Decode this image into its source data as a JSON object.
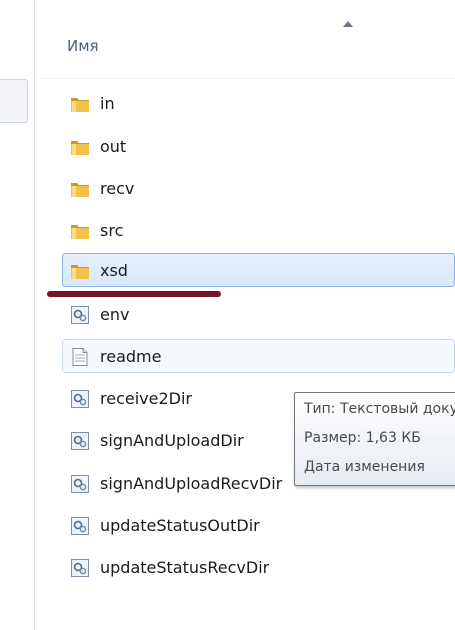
{
  "header": {
    "column_name": "Имя"
  },
  "files": [
    {
      "name": "in",
      "type": "folder"
    },
    {
      "name": "out",
      "type": "folder"
    },
    {
      "name": "recv",
      "type": "folder"
    },
    {
      "name": "src",
      "type": "folder"
    },
    {
      "name": "xsd",
      "type": "folder",
      "state": "selected"
    },
    {
      "name": "env",
      "type": "script"
    },
    {
      "name": "readme",
      "type": "text",
      "state": "hover"
    },
    {
      "name": "receive2Dir",
      "type": "script"
    },
    {
      "name": "signAndUploadDir",
      "type": "script"
    },
    {
      "name": "signAndUploadRecvDir",
      "type": "script"
    },
    {
      "name": "updateStatusOutDir",
      "type": "script"
    },
    {
      "name": "updateStatusRecvDir",
      "type": "script"
    }
  ],
  "tooltip": {
    "type_line": "Тип: Текстовый документ",
    "size_line": "Размер: 1,63 КБ",
    "date_line": "Дата изменения"
  },
  "colors": {
    "selection": "#d7e7fa",
    "selection_border": "#8db2e3",
    "annotation_underline": "#7a1621",
    "folder": "#e8b937"
  }
}
